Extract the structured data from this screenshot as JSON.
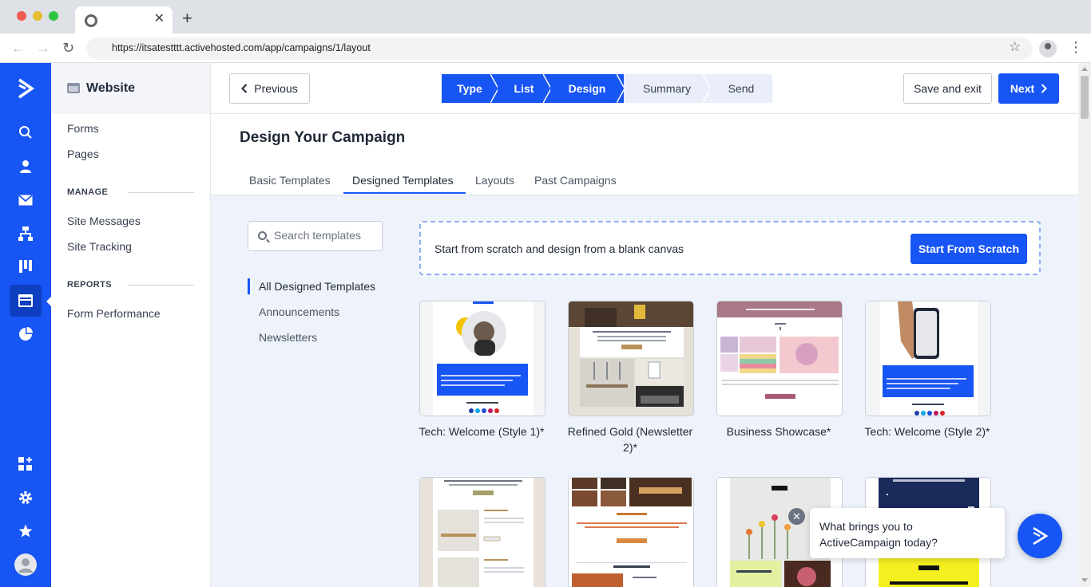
{
  "browser": {
    "url": "https://itsatestttt.activehosted.com/app/campaigns/1/layout",
    "tab_close": "✕",
    "new_tab": "+",
    "back": "←",
    "forward": "→",
    "reload": "↻",
    "star": "☆",
    "menu": "⋮"
  },
  "rail": {
    "icons": [
      "logo-icon",
      "search-icon",
      "contacts-icon",
      "campaigns-icon",
      "automations-icon",
      "pipelines-icon",
      "website-icon",
      "reports-icon",
      "apps-icon",
      "settings-icon",
      "star-icon",
      "avatar-icon"
    ]
  },
  "sidebar": {
    "title": "Website",
    "items": [
      "Forms",
      "Pages"
    ],
    "manage_heading": "MANAGE",
    "manage_items": [
      "Site Messages",
      "Site Tracking"
    ],
    "reports_heading": "REPORTS",
    "reports_items": [
      "Form Performance"
    ]
  },
  "header": {
    "previous_label": "Previous",
    "steps": [
      "Type",
      "List",
      "Design",
      "Summary",
      "Send"
    ],
    "save_label": "Save and exit",
    "next_label": "Next"
  },
  "page": {
    "title": "Design Your Campaign",
    "tabs": [
      "Basic Templates",
      "Designed Templates",
      "Layouts",
      "Past Campaigns"
    ]
  },
  "filters": {
    "search_placeholder": "Search templates",
    "categories": [
      "All Designed Templates",
      "Announcements",
      "Newsletters"
    ]
  },
  "scratch": {
    "text": "Start from scratch and design from a blank canvas",
    "button": "Start From Scratch"
  },
  "templates": [
    {
      "name": "Tech: Welcome (Style 1)*"
    },
    {
      "name": "Refined Gold (Newsletter 2)*"
    },
    {
      "name": "Business Showcase*"
    },
    {
      "name": "Tech: Welcome (Style 2)*"
    }
  ],
  "chat": {
    "message": "What brings you to ActiveCampaign today?",
    "close": "✕"
  },
  "colors": {
    "brand": "#1755f4",
    "brand_dark": "#0d3fc0",
    "content_bg": "#eef2fa"
  }
}
